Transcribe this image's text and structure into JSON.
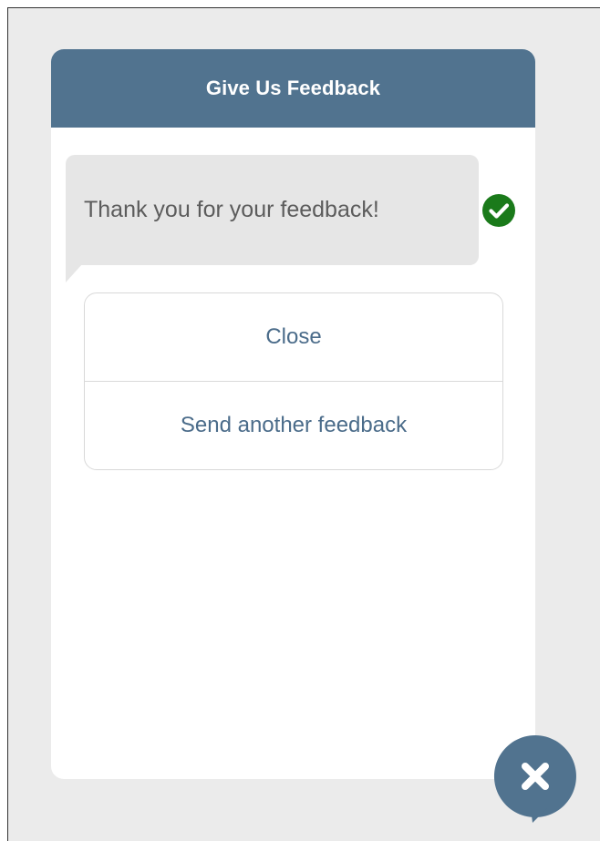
{
  "header": {
    "title": "Give Us Feedback"
  },
  "message": {
    "text": "Thank you for your feedback!",
    "status_icon": "check-circle-icon",
    "status_color": "#1a7a1a"
  },
  "options": [
    {
      "label": "Close"
    },
    {
      "label": "Send another feedback"
    }
  ],
  "close_fab": {
    "icon": "close-icon",
    "color": "#51738f"
  },
  "colors": {
    "header_bg": "#51738f",
    "bubble_bg": "#e6e6e6",
    "link_text": "#4b6c8a"
  }
}
